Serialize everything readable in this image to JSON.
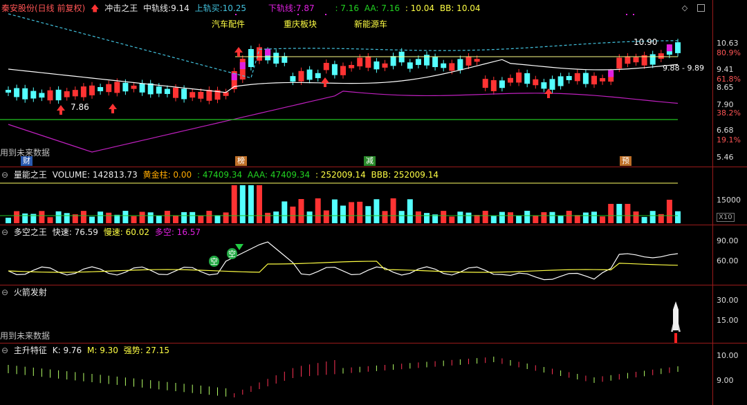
{
  "main": {
    "stock_name": "秦安股份(日线 前复权)",
    "indicator": "冲击之王",
    "mid_label": "中轨线:",
    "mid_value": "9.14",
    "up_label": "上轨买:",
    "up_value": "10.25",
    "down_label": "下轨线:",
    "down_value": "7.87",
    "extra1": ": 7.16",
    "aa": "AA: 7.16",
    "extra2": ": 10.04",
    "bb": "BB: 10.04",
    "sectors": [
      "汽车配件",
      "重庆板块",
      "新能源车"
    ],
    "future_note": "用到未来数据",
    "price_high_label": "10.90",
    "price_low_label": "7.86",
    "range_label": "9.88 - 9.89",
    "axis": [
      "10.63",
      "80.9%",
      "9.41",
      "61.8%",
      "8.65",
      "7.90",
      "38.2%",
      "6.68",
      "19.1%",
      "5.46"
    ],
    "markers": [
      "财",
      "榜",
      "减",
      "预"
    ]
  },
  "volume": {
    "title": "量能之王",
    "vol": "VOLUME: 142813.73",
    "gold": "黄金柱: 0.00",
    "s1": ": 47409.34",
    "aaa": "AAA: 47409.34",
    "s2": ": 252009.14",
    "bbb": "BBB: 252009.14",
    "axis": [
      "15000"
    ],
    "unit": "X10"
  },
  "duokong": {
    "title": "多空之王",
    "fast": "快速: 76.59",
    "slow": "慢速: 60.02",
    "dk": "多空: 16.57",
    "axis": [
      "90.00",
      "60.00"
    ],
    "tags": [
      "空",
      "空"
    ]
  },
  "rocket": {
    "title": "火箭发射",
    "future_note": "用到未来数据",
    "axis": [
      "30.00",
      "15.00"
    ]
  },
  "zhusheng": {
    "title": "主升特征",
    "k": "K: 9.76",
    "m": "M: 9.30",
    "strength": "强势: 27.15",
    "axis": [
      "10.00",
      "9.00"
    ]
  },
  "colors": {
    "up": "#ff3333",
    "down": "#54ffff",
    "mid": "#ffffff",
    "upper": "#43c4e0",
    "lower": "#c020c0",
    "green": "#22c322"
  }
}
